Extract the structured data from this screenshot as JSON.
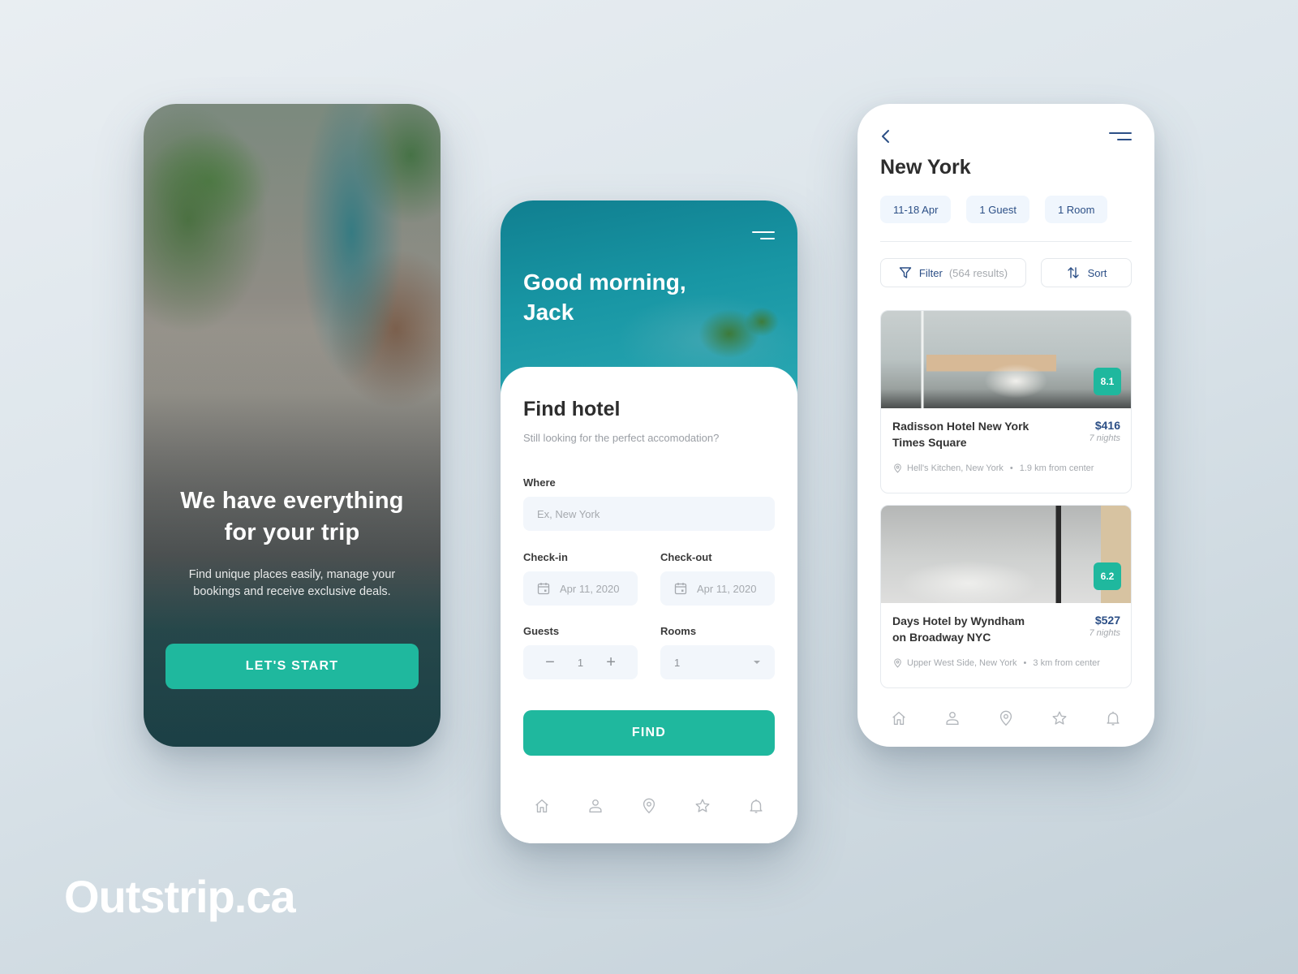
{
  "brand": {
    "name": "Outstrip.ca"
  },
  "colors": {
    "accent": "#1fb89e",
    "primary_text": "#2c4f86",
    "heading": "#2d2d2d",
    "muted": "#a5a9ae",
    "field_bg": "#f2f6fb"
  },
  "onboarding": {
    "title_line1": "We have everything",
    "title_line2": "for your trip",
    "subtitle_line1": "Find unique places easily, manage your",
    "subtitle_line2": "bookings and receive exclusive deals.",
    "cta_label": "LET'S START"
  },
  "search": {
    "greeting_line1": "Good morning,",
    "greeting_line2": "Jack",
    "menu_icon": "menu-icon",
    "title": "Find hotel",
    "subtitle": "Still looking for the perfect accomodation?",
    "where": {
      "label": "Where",
      "value": "",
      "placeholder": "Ex, New York"
    },
    "checkin": {
      "label": "Check-in",
      "value": "Apr 11, 2020",
      "icon": "calendar-icon"
    },
    "checkout": {
      "label": "Check-out",
      "value": "Apr 11, 2020",
      "icon": "calendar-icon"
    },
    "guests": {
      "label": "Guests",
      "value": "1",
      "decrement": "−",
      "increment": "+"
    },
    "rooms": {
      "label": "Rooms",
      "value": "1",
      "icon": "caret-down-icon"
    },
    "find_label": "FIND"
  },
  "nav": {
    "items": [
      {
        "name": "home",
        "icon": "home-icon"
      },
      {
        "name": "profile",
        "icon": "user-icon"
      },
      {
        "name": "location",
        "icon": "map-pin-icon"
      },
      {
        "name": "favorites",
        "icon": "star-icon"
      },
      {
        "name": "notifications",
        "icon": "bell-icon"
      }
    ]
  },
  "results": {
    "city": "New York",
    "chips": [
      "11-18 Apr",
      "1 Guest",
      "1 Room"
    ],
    "filter_label": "Filter",
    "results_count": "(564 results)",
    "sort_label": "Sort",
    "hotels": [
      {
        "name_line1": "Radisson Hotel New York",
        "name_line2": "Times Square",
        "price": "$416",
        "nights": "7 nights",
        "score": "8.1",
        "neighborhood": "Hell's Kitchen, New York",
        "distance": "1.9 km from center"
      },
      {
        "name_line1": "Days Hotel by Wyndham",
        "name_line2": "on Broadway NYC",
        "price": "$527",
        "nights": "7 nights",
        "score": "6.2",
        "neighborhood": "Upper West Side, New York",
        "distance": "3 km from center"
      }
    ]
  }
}
